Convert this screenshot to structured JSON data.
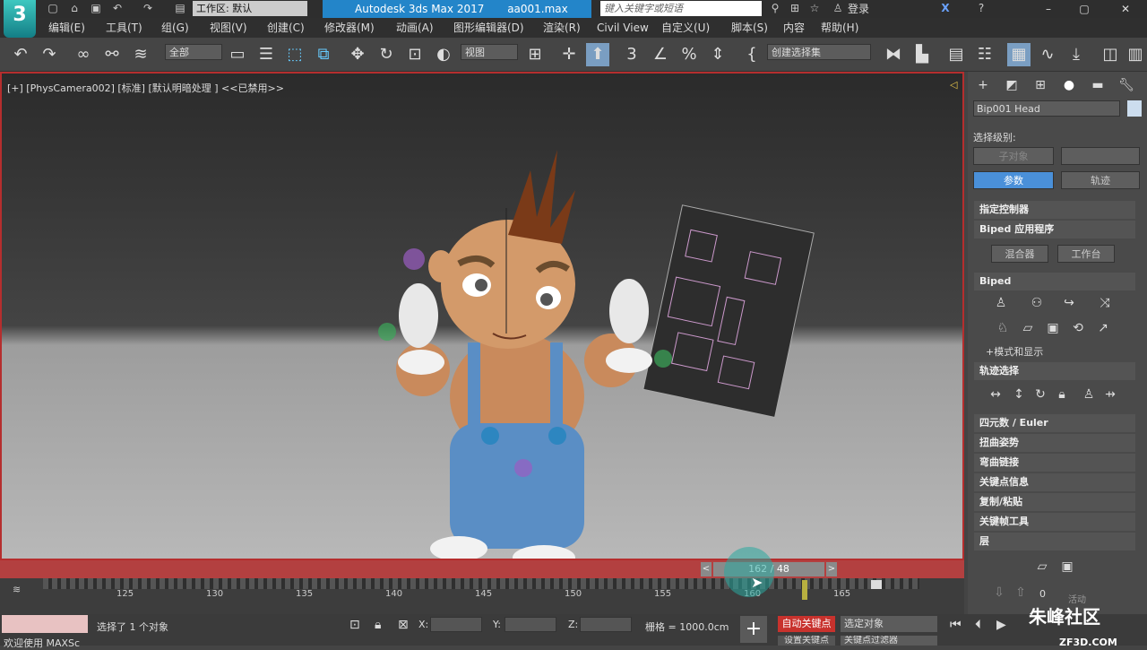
{
  "app": {
    "logo": "3",
    "workspace": "工作区: 默认",
    "title": "Autodesk 3ds Max 2017",
    "file": "aa001.max",
    "search_placeholder": "键入关键字或短语",
    "login": "登录"
  },
  "menu": [
    "编辑(E)",
    "工具(T)",
    "组(G)",
    "视图(V)",
    "创建(C)",
    "修改器(M)",
    "动画(A)",
    "图形编辑器(D)",
    "渲染(R)",
    "Civil View",
    "自定义(U)",
    "脚本(S)",
    "内容",
    "帮助(H)"
  ],
  "toolbar": {
    "filter": "全部",
    "view": "视图",
    "selset": "创建选择集"
  },
  "viewport": {
    "label": "[+] [PhysCamera002] [标准] [默认明暗处理 ] <<已禁用>>"
  },
  "timeslider": {
    "value": "162 / 48"
  },
  "trackbar": {
    "ticks": [
      "125",
      "130",
      "135",
      "140",
      "145",
      "150",
      "155",
      "160",
      "165"
    ]
  },
  "status": {
    "selected": "选择了 1 个对象",
    "welcome": "欢迎使用 MAXSc",
    "x_label": "X:",
    "y_label": "Y:",
    "z_label": "Z:",
    "grid": "栅格 = 1000.0cm",
    "autokey": "自动关键点",
    "selobj": "选定对象",
    "setkey": "设置关键点",
    "keyfilter": "关键点过滤器"
  },
  "cmdpanel": {
    "object_name": "Bip001 Head",
    "sel_level": "选择级别:",
    "sub_object": "子对象",
    "tab_params": "参数",
    "tab_track": "轨迹",
    "rollouts": [
      "指定控制器",
      "Biped 应用程序",
      "Biped",
      "轨迹选择",
      "四元数 / Euler",
      "扭曲姿势",
      "弯曲链接",
      "关键点信息",
      "复制/粘贴",
      "关键帧工具",
      "层"
    ],
    "mixer": "混合器",
    "workbench": "工作台",
    "mode_display": "+模式和显示",
    "layer_value": "0",
    "active": "活动"
  },
  "watermark": {
    "text": "朱峰社区",
    "url": "ZF3D.COM"
  },
  "colors": {
    "accent": "#2385c9",
    "viewport_border": "#b52e2e",
    "autokey": "#c8322d",
    "selected_tab": "#4a90d9"
  }
}
